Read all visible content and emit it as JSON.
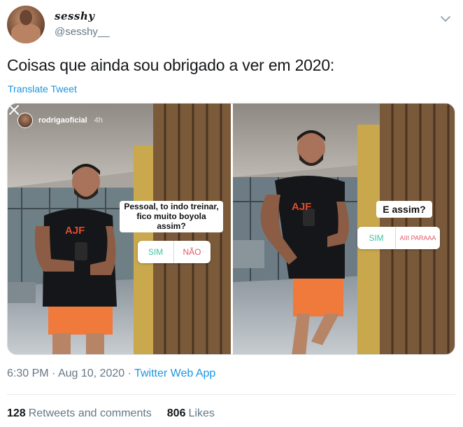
{
  "author": {
    "display_name": "sesshy",
    "handle": "@sesshy__",
    "avatar_icon": "profile-photo-avatar",
    "menu_icon": "chevron-down-icon"
  },
  "tweet": {
    "text": "Coisas que ainda sou obrigado a ver em 2020:",
    "translate_label": "Translate Tweet"
  },
  "media": {
    "left": {
      "story_user": "rodrigaoficial",
      "story_time": "4h",
      "question": "Pessoal, to indo treinar, fico muito boyola assim?",
      "poll_yes": "SIM",
      "poll_no": "NÃO",
      "shirt_logo": "AJF"
    },
    "right": {
      "question": "E assim?",
      "poll_yes": "SIM",
      "poll_no": "AIII PARAAA",
      "shirt_logo": "AJF"
    }
  },
  "meta": {
    "time": "6:30 PM",
    "separator": "·",
    "date": "Aug 10, 2020",
    "source": "Twitter Web App"
  },
  "stats": {
    "retweets_count": "128",
    "retweets_label": "Retweets and comments",
    "likes_count": "806",
    "likes_label": "Likes"
  },
  "colors": {
    "link": "#1b95e0",
    "muted": "#657786",
    "poll_yes": "#3cc6a0",
    "poll_no": "#e05a6a"
  }
}
